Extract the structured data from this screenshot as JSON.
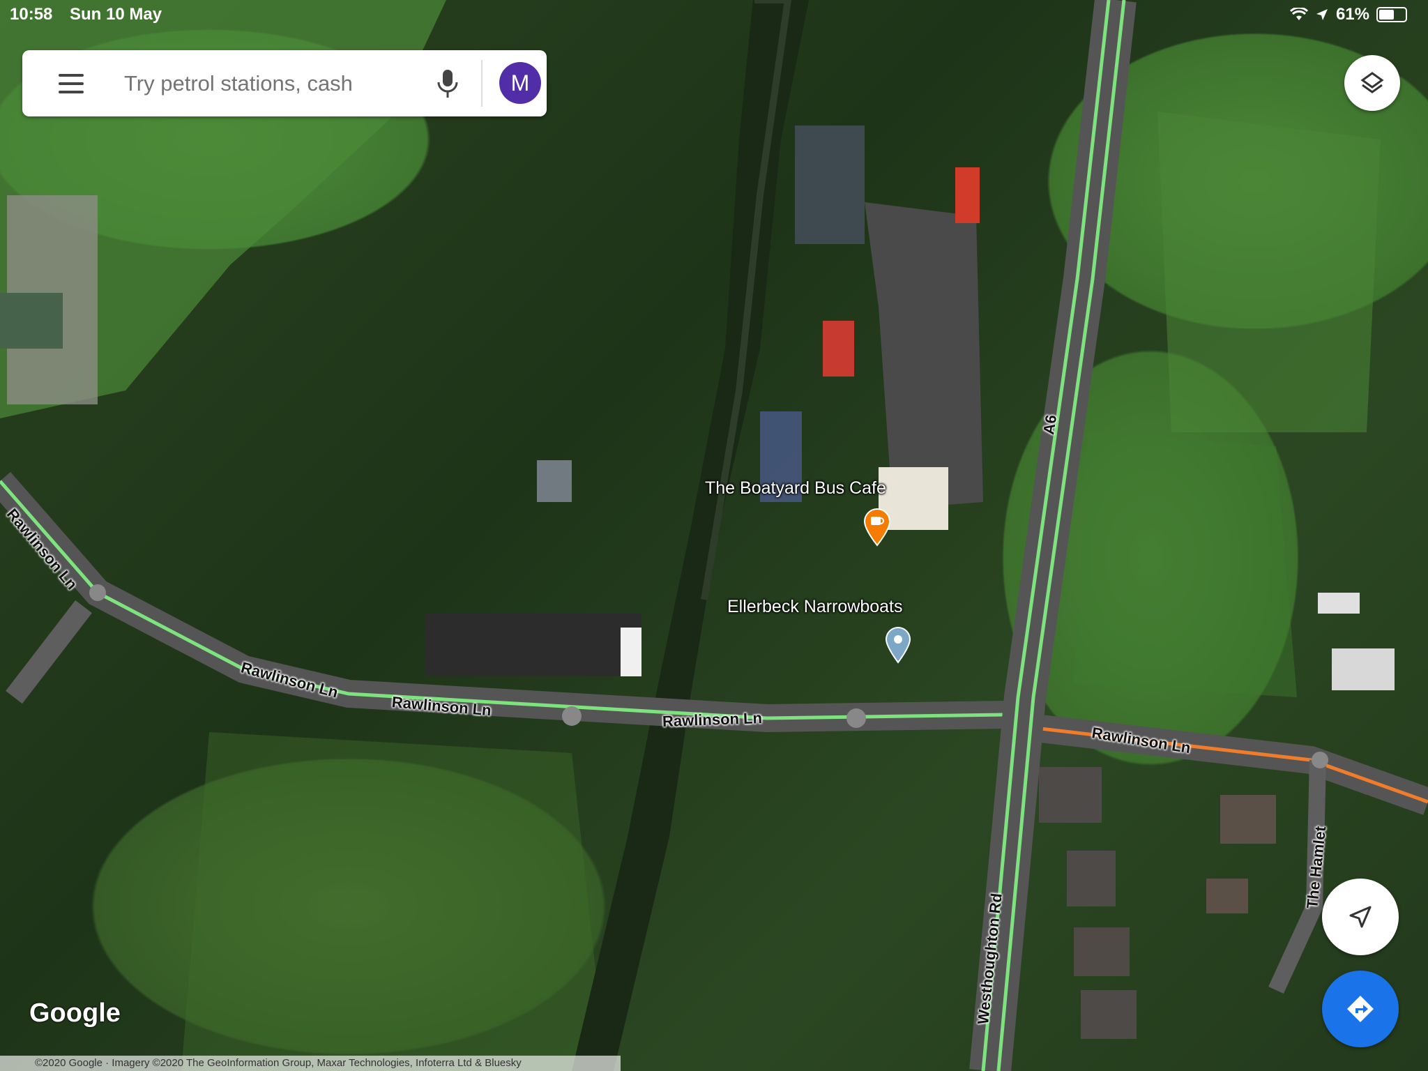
{
  "status_bar": {
    "time": "10:58",
    "date": "Sun 10 May",
    "battery": "61%",
    "battery_level": 0.61
  },
  "search": {
    "placeholder": "Try petrol stations, cash",
    "avatar_initial": "M",
    "avatar_color": "#512da8"
  },
  "map": {
    "places": [
      {
        "name": "The Boatyard Bus Cafe",
        "icon": "cafe-pin-icon",
        "color": "#f57c00"
      },
      {
        "name": "Ellerbeck Narrowboats",
        "icon": "location-pin-icon",
        "color": "#7da7c7"
      }
    ],
    "roads": {
      "a6": "A6",
      "rawlinson_1": "Rawlinson Ln",
      "rawlinson_2": "Rawlinson Ln",
      "rawlinson_3": "Rawlinson Ln",
      "rawlinson_4": "Rawlinson Ln",
      "rawlinson_5": "Rawlinson Ln",
      "westhoughton": "Westhoughton Rd",
      "hamlet": "The Hamlet"
    },
    "traffic_colors": {
      "clear": "#7ee27e",
      "slow": "#f07d2b"
    }
  },
  "controls": {
    "layers": "layers-icon",
    "locate": "navigation-arrow-icon",
    "directions": "directions-icon"
  },
  "footer": {
    "logo": "Google",
    "attribution": "©2020 Google · Imagery ©2020 The GeoInformation Group, Maxar Technologies, Infoterra Ltd & Bluesky"
  }
}
